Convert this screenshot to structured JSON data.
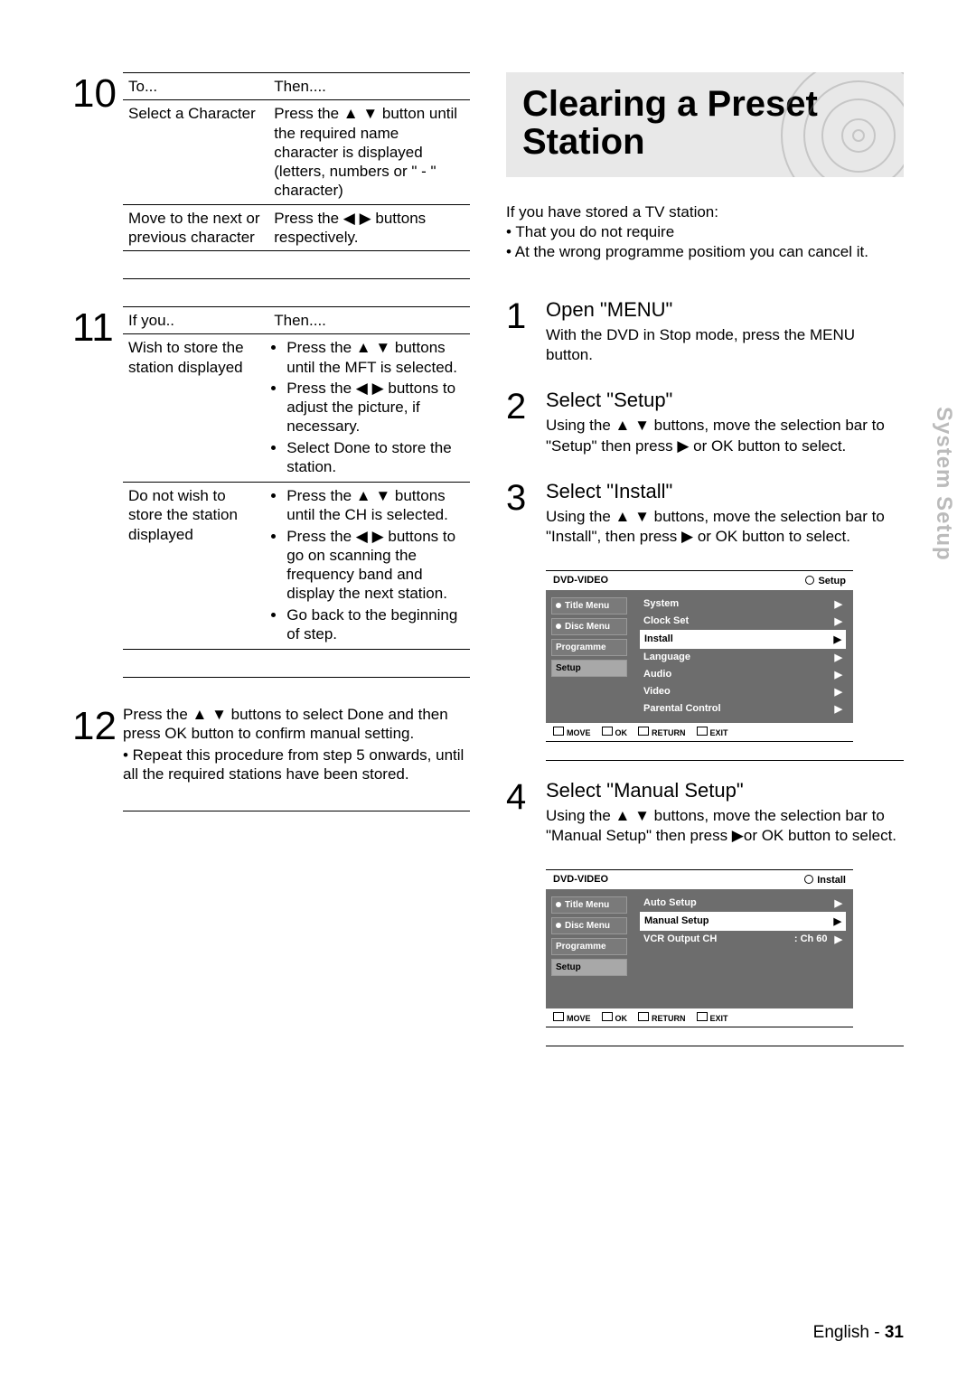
{
  "left": {
    "step10": {
      "num": "10",
      "header_to": "To...",
      "header_then": "Then....",
      "row1_to": "Select a Character",
      "row1_then": "Press the ▲ ▼ button until the required name character is displayed (letters, numbers or \" - \" character)",
      "row2_to": "Move to the next or previous character",
      "row2_then": "Press the ◀ ▶ buttons respectively."
    },
    "step11": {
      "num": "11",
      "header_if": "If you..",
      "header_then": "Then....",
      "row1_if": "Wish to store the station displayed",
      "row1_a": "Press the ▲ ▼ buttons until the MFT is selected.",
      "row1_b": "Press the ◀ ▶ buttons to adjust the picture, if necessary.",
      "row1_c": "Select Done to store the station.",
      "row2_if": "Do not wish to store the station displayed",
      "row2_a": "Press the ▲ ▼ buttons until the CH is selected.",
      "row2_b": "Press the ◀ ▶ buttons to go on scanning the frequency band and display the next station.",
      "row2_c": "Go back to the beginning of step."
    },
    "step12": {
      "num": "12",
      "line1": "Press the ▲ ▼ buttons to select Done and then press OK button to confirm manual setting.",
      "line2": "• Repeat this procedure from step 5 onwards, until all the required stations have been stored."
    }
  },
  "right": {
    "title": "Clearing a Preset Station",
    "intro1": "If you have stored a TV station:",
    "intro2": "That you do not require",
    "intro3": "At the wrong programme positiom you can cancel it.",
    "s1n": "1",
    "s1h": "Open \"MENU\"",
    "s1t": "With the DVD in Stop mode, press the MENU button.",
    "s2n": "2",
    "s2h": "Select \"Setup\"",
    "s2t": "Using the ▲ ▼ buttons, move the selection bar to \"Setup\" then press ▶ or OK button to select.",
    "s3n": "3",
    "s3h": "Select \"Install\"",
    "s3t": "Using the ▲ ▼ buttons, move the selection bar to \"Install\", then press  ▶ or OK button to select.",
    "s4n": "4",
    "s4h": "Select \"Manual Setup\"",
    "s4t": "Using the ▲ ▼ buttons, move the selection bar to \"Manual Setup\" then press ▶or OK button to select."
  },
  "osd": {
    "brand": "DVD-VIDEO",
    "crumb_setup": "Setup",
    "crumb_install": "Install",
    "left_items": [
      "Title Menu",
      "Disc Menu",
      "Programme",
      "Setup"
    ],
    "setup_items": [
      "System",
      "Clock Set",
      "Install",
      "Language",
      "Audio",
      "Video",
      "Parental Control"
    ],
    "install_items": [
      "Auto Setup",
      "Manual Setup",
      "VCR Output CH"
    ],
    "install_val": ": Ch 60",
    "foot": [
      "MOVE",
      "OK",
      "RETURN",
      "EXIT"
    ]
  },
  "side_tab": "System Setup",
  "footer_lang": "English - ",
  "footer_page": "31"
}
